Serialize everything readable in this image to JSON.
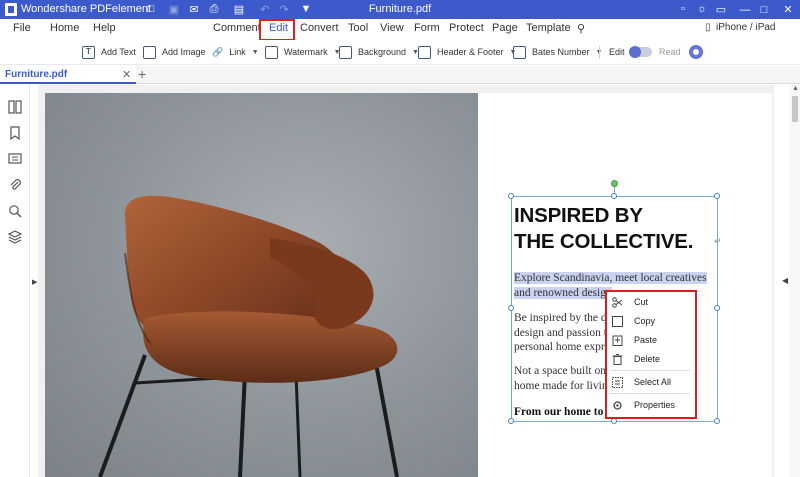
{
  "app": {
    "name": "Wondershare PDFelement",
    "document_title": "Furniture.pdf"
  },
  "menu": {
    "items": [
      "File",
      "Home",
      "Help",
      "Comment",
      "Edit",
      "Convert",
      "Tool",
      "View",
      "Form",
      "Protect",
      "Page",
      "Template"
    ],
    "active": "Edit",
    "device": "iPhone / iPad"
  },
  "toolbar": {
    "add_text": "Add Text",
    "add_image": "Add Image",
    "link": "Link",
    "watermark": "Watermark",
    "background": "Background",
    "header_footer": "Header & Footer",
    "bates_number": "Bates Number",
    "edit": "Edit",
    "read": "Read"
  },
  "tabs": [
    {
      "label": "Furniture.pdf"
    }
  ],
  "document": {
    "headline_1": "INSPIRED BY",
    "headline_2": "THE COLLECTIVE.",
    "para1": [
      "Explore Scandinavia, meet local creatives",
      "and renowned design"
    ],
    "para2": [
      "Be inspired by the de",
      "design and passion t",
      "personal home expre"
    ],
    "para3": [
      "Not a space built on",
      "home made for living"
    ],
    "para4": "From our home to yo"
  },
  "context_menu": {
    "items": [
      {
        "label": "Cut",
        "icon": "cut-icon"
      },
      {
        "label": "Copy",
        "icon": "copy-icon"
      },
      {
        "label": "Paste",
        "icon": "paste-icon"
      },
      {
        "label": "Delete",
        "icon": "delete-icon"
      },
      {
        "label": "Select All",
        "icon": "select-all-icon"
      },
      {
        "label": "Properties",
        "icon": "properties-icon"
      }
    ]
  },
  "colors": {
    "brand": "#3c5acb",
    "highlight_box": "#e02020",
    "selection": "#c9d3f0"
  }
}
